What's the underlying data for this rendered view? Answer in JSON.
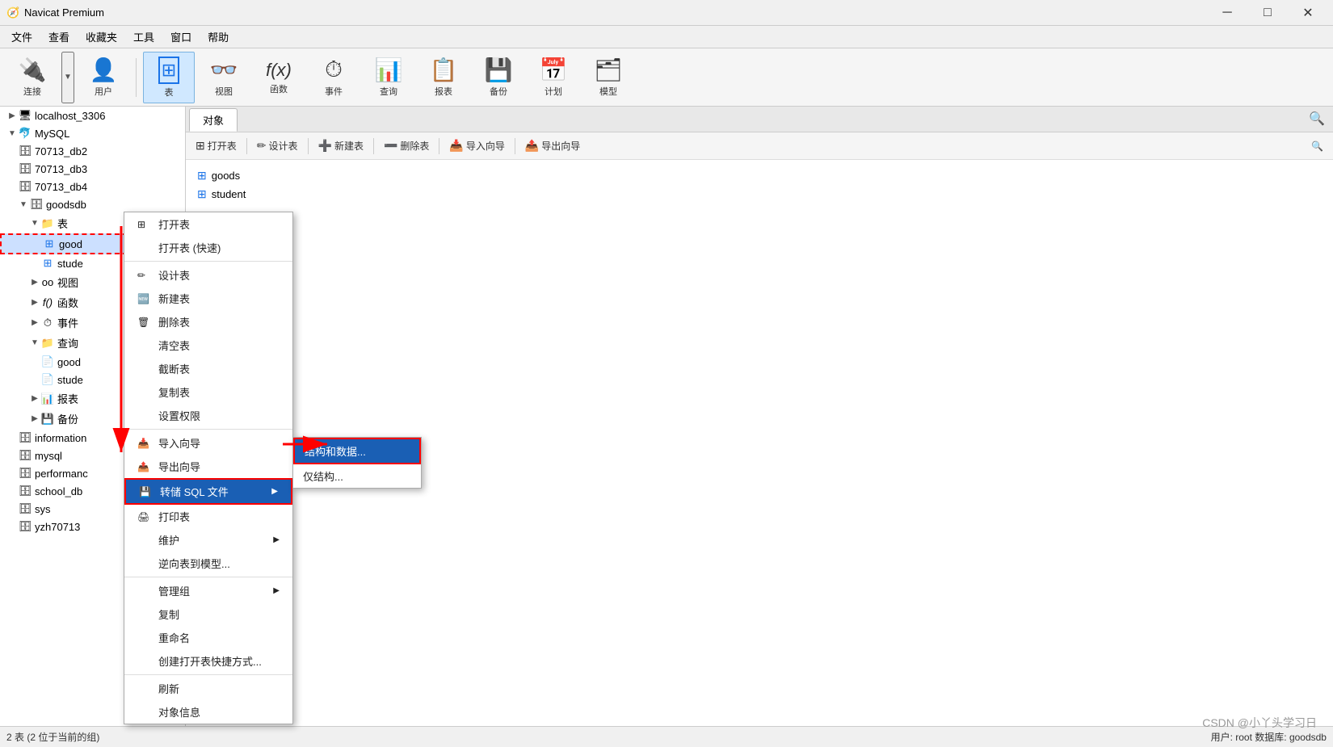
{
  "titleBar": {
    "title": "Navicat Premium",
    "controls": [
      "minimize",
      "maximize",
      "close"
    ]
  },
  "menuBar": {
    "items": [
      "文件",
      "查看",
      "收藏夹",
      "工具",
      "窗口",
      "帮助"
    ]
  },
  "toolbar": {
    "items": [
      {
        "id": "connect",
        "label": "连接",
        "icon": "🔌"
      },
      {
        "id": "user",
        "label": "用户",
        "icon": "👤"
      },
      {
        "id": "table",
        "label": "表",
        "icon": "⊞",
        "active": true
      },
      {
        "id": "view",
        "label": "视图",
        "icon": "👓"
      },
      {
        "id": "function",
        "label": "函数",
        "icon": "ƒ"
      },
      {
        "id": "event",
        "label": "事件",
        "icon": "⏱"
      },
      {
        "id": "query",
        "label": "查询",
        "icon": "📊"
      },
      {
        "id": "report",
        "label": "报表",
        "icon": "📋"
      },
      {
        "id": "backup",
        "label": "备份",
        "icon": "💾"
      },
      {
        "id": "plan",
        "label": "计划",
        "icon": "📅"
      },
      {
        "id": "model",
        "label": "模型",
        "icon": "🗂"
      }
    ]
  },
  "tabs": {
    "items": [
      {
        "label": "对象"
      }
    ]
  },
  "actionToolbar": {
    "buttons": [
      {
        "label": "打开表",
        "icon": "⊞"
      },
      {
        "label": "设计表",
        "icon": "✏"
      },
      {
        "label": "新建表",
        "icon": "➕"
      },
      {
        "label": "删除表",
        "icon": "➖"
      },
      {
        "label": "导入向导",
        "icon": "📥"
      },
      {
        "label": "导出向导",
        "icon": "📤"
      }
    ]
  },
  "sidebar": {
    "items": [
      {
        "id": "localhost",
        "label": "localhost_3306",
        "level": 0,
        "type": "server",
        "expanded": false
      },
      {
        "id": "mysql-root",
        "label": "MySQL",
        "level": 0,
        "type": "db-root",
        "expanded": true
      },
      {
        "id": "db1",
        "label": "70713_db2",
        "level": 1,
        "type": "database"
      },
      {
        "id": "db2",
        "label": "70713_db3",
        "level": 1,
        "type": "database"
      },
      {
        "id": "db3",
        "label": "70713_db4",
        "level": 1,
        "type": "database"
      },
      {
        "id": "goodsdb",
        "label": "goodsdb",
        "level": 1,
        "type": "database",
        "expanded": true
      },
      {
        "id": "tables-node",
        "label": "表",
        "level": 2,
        "type": "folder",
        "expanded": true
      },
      {
        "id": "goods-table",
        "label": "good",
        "level": 3,
        "type": "table",
        "selected": true
      },
      {
        "id": "student-table",
        "label": "stude",
        "level": 3,
        "type": "table"
      },
      {
        "id": "views-node",
        "label": "视图",
        "level": 2,
        "type": "folder",
        "expanded": false
      },
      {
        "id": "func-node",
        "label": "函数",
        "level": 2,
        "type": "folder",
        "expanded": false
      },
      {
        "id": "event-node",
        "label": "事件",
        "level": 2,
        "type": "folder",
        "expanded": false
      },
      {
        "id": "query-node",
        "label": "查询",
        "level": 2,
        "type": "folder",
        "expanded": true
      },
      {
        "id": "good-query",
        "label": "good",
        "level": 3,
        "type": "query"
      },
      {
        "id": "stude-query",
        "label": "stude",
        "level": 3,
        "type": "query"
      },
      {
        "id": "report-node",
        "label": "报表",
        "level": 2,
        "type": "folder"
      },
      {
        "id": "backup-node",
        "label": "备份",
        "level": 2,
        "type": "folder"
      },
      {
        "id": "infodb",
        "label": "information",
        "level": 1,
        "type": "database"
      },
      {
        "id": "mysqldb",
        "label": "mysql",
        "level": 1,
        "type": "database"
      },
      {
        "id": "performancedb",
        "label": "performanc",
        "level": 1,
        "type": "database"
      },
      {
        "id": "schooldb",
        "label": "school_db",
        "level": 1,
        "type": "database"
      },
      {
        "id": "sysdb",
        "label": "sys",
        "level": 1,
        "type": "database"
      },
      {
        "id": "yzhdb",
        "label": "yzh70713",
        "level": 1,
        "type": "database"
      }
    ]
  },
  "objectList": {
    "items": [
      {
        "label": "goods",
        "icon": "⊞"
      },
      {
        "label": "student",
        "icon": "⊞"
      }
    ]
  },
  "contextMenu": {
    "items": [
      {
        "label": "打开表",
        "icon": "⊞",
        "type": "item"
      },
      {
        "label": "打开表 (快速)",
        "icon": "",
        "type": "item"
      },
      {
        "type": "separator"
      },
      {
        "label": "设计表",
        "icon": "✏",
        "type": "item"
      },
      {
        "label": "新建表",
        "icon": "➕",
        "type": "item"
      },
      {
        "label": "删除表",
        "icon": "🗑",
        "type": "item"
      },
      {
        "label": "清空表",
        "icon": "",
        "type": "item"
      },
      {
        "label": "截断表",
        "icon": "",
        "type": "item"
      },
      {
        "label": "复制表",
        "icon": "",
        "type": "item"
      },
      {
        "label": "设置权限",
        "icon": "",
        "type": "item"
      },
      {
        "type": "separator"
      },
      {
        "label": "导入向导",
        "icon": "📥",
        "type": "item"
      },
      {
        "label": "导出向导",
        "icon": "📤",
        "type": "item"
      },
      {
        "label": "转储 SQL 文件",
        "icon": "💾",
        "type": "item",
        "hasArrow": true,
        "highlighted": true
      },
      {
        "label": "打印表",
        "icon": "🖨",
        "type": "item"
      },
      {
        "label": "维护",
        "icon": "",
        "type": "item",
        "hasArrow": true
      },
      {
        "label": "逆向表到模型...",
        "icon": "",
        "type": "item"
      },
      {
        "type": "separator"
      },
      {
        "label": "管理组",
        "icon": "",
        "type": "item",
        "hasArrow": true
      },
      {
        "label": "复制",
        "icon": "",
        "type": "item"
      },
      {
        "label": "重命名",
        "icon": "",
        "type": "item"
      },
      {
        "label": "创建打开表快捷方式...",
        "icon": "",
        "type": "item"
      },
      {
        "type": "separator"
      },
      {
        "label": "刷新",
        "icon": "",
        "type": "item"
      },
      {
        "label": "对象信息",
        "icon": "",
        "type": "item"
      }
    ]
  },
  "subContextMenu": {
    "items": [
      {
        "label": "结构和数据...",
        "highlighted": true
      },
      {
        "label": "仅结构..."
      }
    ]
  },
  "statusBar": {
    "left": "2 表 (2 位于当前的组)",
    "right": "用户: root  数据库: goodsdb"
  },
  "watermark": "CSDN @小丫头学习日"
}
